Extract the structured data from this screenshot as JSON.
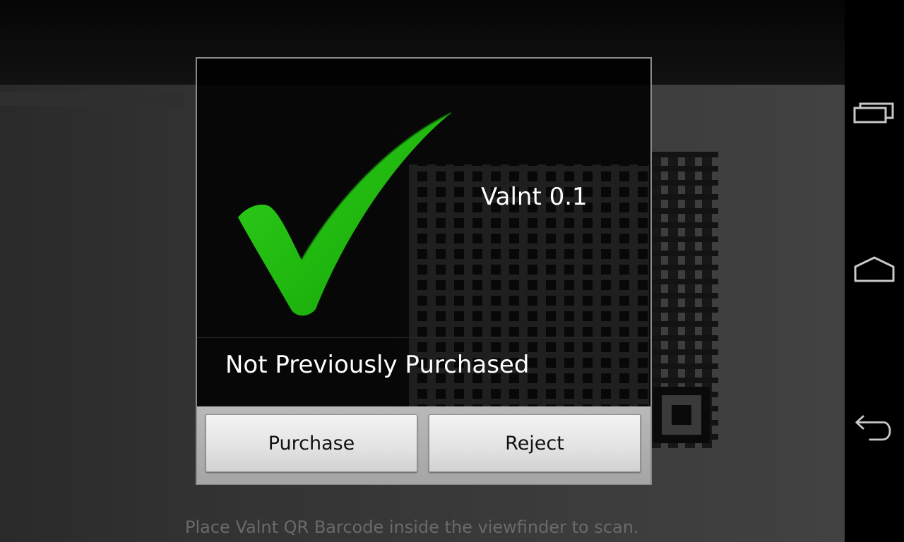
{
  "dialog": {
    "title": "Valnt 0.1",
    "message": "Not Previously Purchased",
    "purchase_label": "Purchase",
    "reject_label": "Reject",
    "status_icon": "checkmark-icon",
    "status_color": "#1fb50f"
  },
  "viewfinder": {
    "hint": "Place Valnt QR Barcode inside the viewfinder to scan."
  },
  "navbar": {
    "items": [
      "recent-apps-icon",
      "home-icon",
      "back-icon"
    ]
  }
}
